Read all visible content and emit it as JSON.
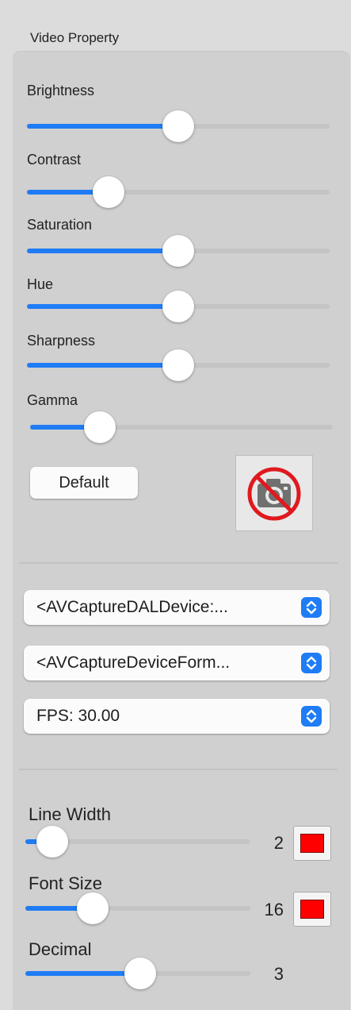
{
  "group_title": "Video Property",
  "sliders": [
    {
      "label": "Brightness",
      "value": 0.5
    },
    {
      "label": "Contrast",
      "value": 0.27
    },
    {
      "label": "Saturation",
      "value": 0.5
    },
    {
      "label": "Hue",
      "value": 0.5
    },
    {
      "label": "Sharpness",
      "value": 0.5
    },
    {
      "label": "Gamma",
      "value": 0.23
    }
  ],
  "default_button": "Default",
  "camera_icon": "camera-disabled-icon",
  "popups": [
    {
      "value": "<AVCaptureDALDevice:..."
    },
    {
      "value": "<AVCaptureDeviceForm..."
    },
    {
      "value": "FPS: 30.00"
    }
  ],
  "drawing": [
    {
      "label": "Line Width",
      "value": "2",
      "level": 0.12,
      "color": "#ff0000"
    },
    {
      "label": "Font Size",
      "value": "16",
      "level": 0.3,
      "color": "#ff0000"
    },
    {
      "label": "Decimal",
      "value": "3",
      "level": 0.51
    }
  ],
  "colors": {
    "accent": "#1f7cf5",
    "swatch": "#ff0000",
    "no_symbol": "#e0191f"
  }
}
